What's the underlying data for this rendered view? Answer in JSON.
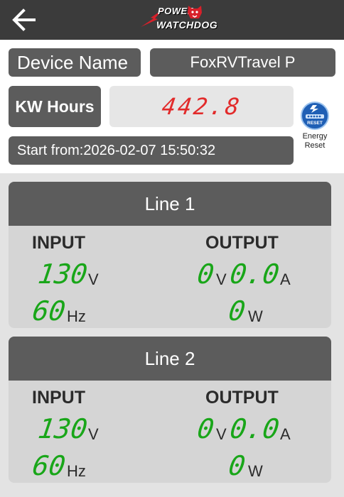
{
  "header": {
    "brand_line1": "POWER",
    "brand_line2": "WATCHDOG"
  },
  "device": {
    "name_label": "Device Name",
    "name_value": "FoxRVTravel  P"
  },
  "energy": {
    "kw_label": "KW Hours",
    "kw_value": "442.8",
    "start_text": "Start from:2026-02-07 15:50:32",
    "reset_line1": "Energy",
    "reset_line2": "Reset",
    "reset_badge": "RESET"
  },
  "lines": [
    {
      "title": "Line 1",
      "input_header": "INPUT",
      "output_header": "OUTPUT",
      "input_voltage": "130",
      "input_voltage_unit": "V",
      "input_freq": "60",
      "input_freq_unit": "Hz",
      "output_voltage": "0",
      "output_voltage_unit": "V",
      "output_current": "0.0",
      "output_current_unit": "A",
      "output_power": "0",
      "output_power_unit": "W"
    },
    {
      "title": "Line 2",
      "input_header": "INPUT",
      "output_header": "OUTPUT",
      "input_voltage": "130",
      "input_voltage_unit": "V",
      "input_freq": "60",
      "input_freq_unit": "Hz",
      "output_voltage": "0",
      "output_voltage_unit": "V",
      "output_current": "0.0",
      "output_current_unit": "A",
      "output_power": "0",
      "output_power_unit": "W"
    }
  ],
  "colors": {
    "kw_digits": "#e22b2b",
    "reading_digits": "#19a619",
    "header_bg": "#3b3b3b",
    "pill_bg": "#5c5c5c"
  }
}
